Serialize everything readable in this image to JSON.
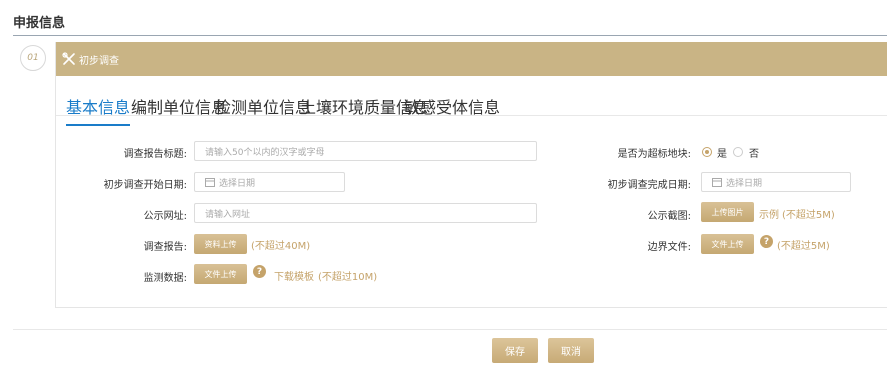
{
  "page": {
    "title": "申报信息"
  },
  "step": {
    "number": "01",
    "title": "初步调查"
  },
  "tabs": [
    {
      "label": "基本信息",
      "active": true
    },
    {
      "label": "编制单位信息",
      "active": false
    },
    {
      "label": "检测单位信息",
      "active": false
    },
    {
      "label": "土壤环境质量信息",
      "active": false
    },
    {
      "label": "敏感受体信息",
      "active": false
    }
  ],
  "form": {
    "report_title": {
      "label": "调查报告标题:",
      "placeholder": "请输入50个以内的汉字或字母"
    },
    "start_date": {
      "label": "初步调查开始日期:",
      "placeholder": "选择日期"
    },
    "public_url": {
      "label": "公示网址:",
      "placeholder": "请输入网址"
    },
    "survey_report": {
      "label": "调查报告:",
      "button": "资料上传",
      "note": "(不超过40M)"
    },
    "monitor_data": {
      "label": "监测数据:",
      "button": "文件上传",
      "template_link": "下载模板",
      "note": "(不超过10M)"
    },
    "over_standard": {
      "label": "是否为超标地块:",
      "yes": "是",
      "no": "否",
      "selected": "是"
    },
    "end_date": {
      "label": "初步调查完成日期:",
      "placeholder": "选择日期"
    },
    "public_screenshot": {
      "label": "公示截图:",
      "button": "上传图片",
      "example": "示例",
      "note": "(不超过5M)"
    },
    "boundary_file": {
      "label": "边界文件:",
      "button": "文件上传",
      "note": "(不超过5M)"
    }
  },
  "actions": {
    "save": "保存",
    "cancel": "取消"
  },
  "colors": {
    "accent": "#c9b485",
    "tab_active": "#1a7cc9",
    "note": "#c5a36a"
  }
}
